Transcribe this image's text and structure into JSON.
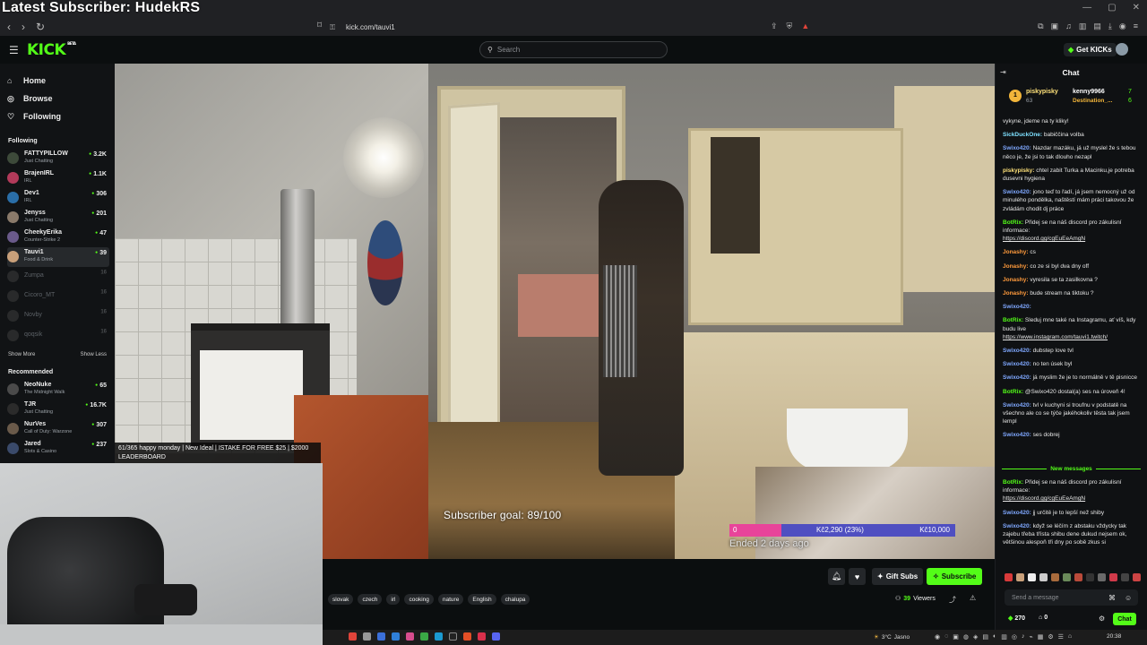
{
  "overlay": {
    "title": "Latest Subscriber: HudekRS"
  },
  "browser": {
    "url": "kick.com/tauvi1"
  },
  "header": {
    "logo": "KICK",
    "logo_sup": "BETA",
    "search_placeholder": "Search",
    "get_kicks": "Get KICKs"
  },
  "sidebar": {
    "nav": [
      {
        "label": "Home",
        "icon": "home-icon"
      },
      {
        "label": "Browse",
        "icon": "compass-icon"
      },
      {
        "label": "Following",
        "icon": "heart-icon"
      }
    ],
    "following_label": "Following",
    "following": [
      {
        "name": "FATTYPILLOW",
        "category": "Just Chatting",
        "viewers": "3.2K",
        "color": "#3d4a3a"
      },
      {
        "name": "BrajenIRL",
        "category": "IRL",
        "viewers": "1.1K",
        "color": "#b23a5a"
      },
      {
        "name": "Dev1",
        "category": "IRL",
        "viewers": "306",
        "color": "#2a6ea8"
      },
      {
        "name": "Jenyss",
        "category": "Just Chatting",
        "viewers": "201",
        "color": "#8a7a6a"
      },
      {
        "name": "CheekyErika",
        "category": "Counter-Strike 2",
        "viewers": "47",
        "color": "#6a5a8a"
      },
      {
        "name": "Tauvi1",
        "category": "Food & Drink",
        "viewers": "39",
        "color": "#c9a07a"
      }
    ],
    "offline": [
      {
        "name": "Zumpa",
        "viewers": "16"
      },
      {
        "name": "Cicoro_MT",
        "viewers": "16"
      },
      {
        "name": "Novby",
        "viewers": "16"
      },
      {
        "name": "qoqsik",
        "viewers": "16"
      }
    ],
    "show_more": "Show More",
    "show_less": "Show Less",
    "recommended_label": "Recommended",
    "recommended": [
      {
        "name": "NeoNuke",
        "category": "The Midnight Walk",
        "viewers": "65",
        "color": "#4a4a4a"
      },
      {
        "name": "TJR",
        "category": "Just Chatting",
        "viewers": "16.7K",
        "color": "#2b2b2b"
      },
      {
        "name": "NurVes",
        "category": "Call of Duty: Warzone",
        "viewers": "307",
        "color": "#6a5a4a"
      },
      {
        "name": "Jared",
        "category": "Slots & Casino",
        "viewers": "237",
        "color": "#3a4a6a"
      }
    ]
  },
  "alert_text": "61/365 happy monday | New Ideal | ISTAKE FOR FREE $25 | $2000 LEADERBOARD",
  "video": {
    "subscriber_goal": "Subscriber goal: 89/100",
    "goal_min": "0",
    "goal_current": "Kč2,290 (23%)",
    "goal_max": "Kč10,000",
    "goal_progress": 0.23,
    "ended": "Ended 2 days ago"
  },
  "actions": {
    "gift_subs": "Gift Subs",
    "subscribe": "Subscribe",
    "viewers_count": "39",
    "viewers_label": "Viewers"
  },
  "tags": [
    "slovak",
    "czech",
    "irl",
    "cooking",
    "nature",
    "English",
    "chalupa"
  ],
  "taskbar": {
    "temp": "3°C",
    "weather": "Jasno",
    "time": "20:38"
  },
  "chat": {
    "title": "Chat",
    "pinned": {
      "user1": "piskypisky",
      "user1_sub": "63",
      "user2": "kenny9966",
      "user2_sub": "Destination_...",
      "n1": "7",
      "n2": "6"
    },
    "messages": [
      {
        "user": "",
        "color": "#e6e6e6",
        "text": "vykyne, jdeme na ty kliky!"
      },
      {
        "user": "SickDuckOne:",
        "color": "#7ee0ff",
        "text": "babiččina volba"
      },
      {
        "user": "Swixo420:",
        "color": "#7fa8ff",
        "text": "Nazdar mazáku, já už myslel že s tebou něco je, že jsi to tak dlouho nezapl"
      },
      {
        "user": "piskypisky:",
        "color": "#ffe27a",
        "text": "chtel zabit Turka a Macinku,je potreba dusevni hygiena"
      },
      {
        "user": "Swixo420:",
        "color": "#7fa8ff",
        "text": "jono teď to řadí, já jsem nemocný už od minulého pondělka, naštěstí mám práci takovou že zvládám chodit dj práce"
      },
      {
        "user": "BotRix:",
        "color": "#53fc18",
        "text": "Přidej se na náš discord pro zákulisní informace:",
        "link": "https://discord.gg/cgEuEeAmgN"
      },
      {
        "user": "Jonashy:",
        "color": "#ff9a3c",
        "text": "cs"
      },
      {
        "user": "Jonashy:",
        "color": "#ff9a3c",
        "text": "co ze si byl dva dny off"
      },
      {
        "user": "Jonashy:",
        "color": "#ff9a3c",
        "text": "vyresila se ta zasilkovna ?"
      },
      {
        "user": "Jonashy:",
        "color": "#ff9a3c",
        "text": "bude stream na tiktoku ?"
      },
      {
        "user": "Swixo420:",
        "color": "#7fa8ff",
        "text": ""
      },
      {
        "user": "BotRix:",
        "color": "#53fc18",
        "text": "Sleduj mne také na Instagramu, ať víš, kdy budu live",
        "link": "https://www.instagram.com/tauvi1.twitch/"
      },
      {
        "user": "Swixo420:",
        "color": "#7fa8ff",
        "text": "dubstep love tvl"
      },
      {
        "user": "Swixo420:",
        "color": "#7fa8ff",
        "text": "no ten úsek byl"
      },
      {
        "user": "Swixo420:",
        "color": "#7fa8ff",
        "text": "já myslim že je to normálně v tě pisnicce"
      },
      {
        "user": "BotRix:",
        "color": "#53fc18",
        "text": "@Swixo420 dostal(a) ses na úroveň 4!"
      },
      {
        "user": "Swixo420:",
        "color": "#7fa8ff",
        "text": "tvl v kuchyni si troufnu v podstatě na všechno ale co se týče jakéhokoliv těsta tak jsem lempl"
      },
      {
        "user": "Swixo420:",
        "color": "#7fa8ff",
        "text": "ses dobrej"
      }
    ],
    "new_messages": "New messages",
    "messages2": [
      {
        "user": "BotRix:",
        "color": "#53fc18",
        "text": "Přidej se na náš discord pro zákulisní informace:",
        "link": "https://discord.gg/cgEuEeAmgN"
      },
      {
        "user": "Swixo420:",
        "color": "#7fa8ff",
        "text": "jj určitě je to lepší než shiby"
      },
      {
        "user": "Swixo420:",
        "color": "#7fa8ff",
        "text": "když se léčím z abstaku vždycky tak zajebu třeba třísta shibu dene dukud nejsem ok, většinou alespoň tři dny po sobě zkus si"
      }
    ],
    "input_placeholder": "Send a message",
    "kicks": "270",
    "subs": "0",
    "chat_button": "Chat"
  }
}
